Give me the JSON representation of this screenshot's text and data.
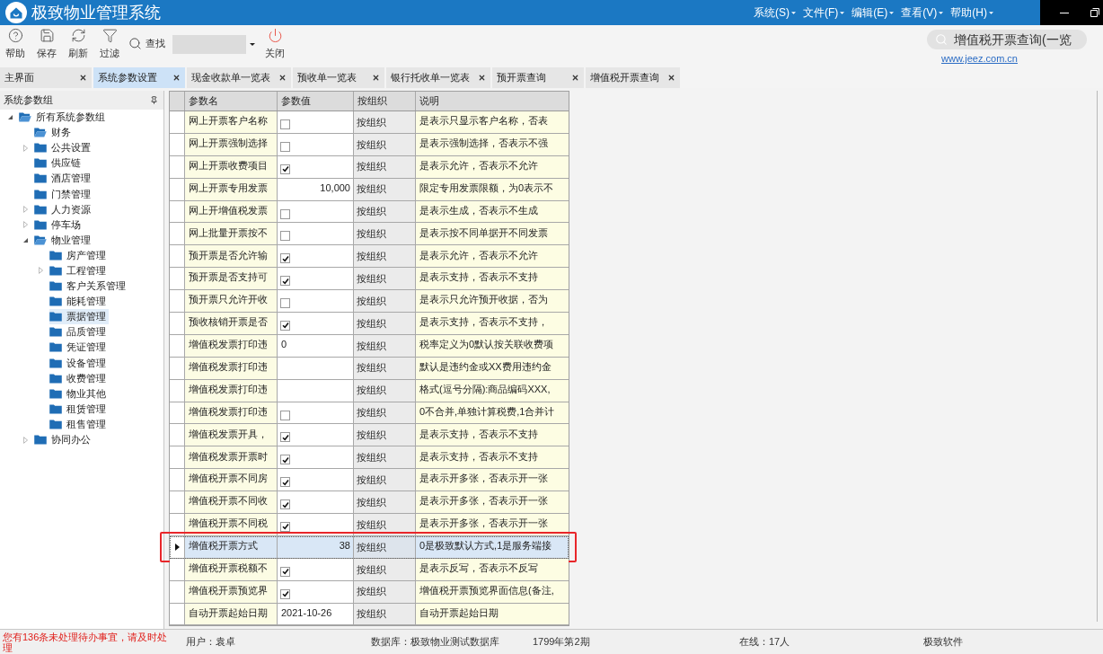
{
  "window": {
    "title": "极致物业管理系统"
  },
  "menu": [
    "系统(S)",
    "文件(F)",
    "编辑(E)",
    "查看(V)",
    "帮助(H)"
  ],
  "toolbar": {
    "buttons": [
      {
        "kind": "help",
        "label": "帮助"
      },
      {
        "kind": "save",
        "label": "保存"
      },
      {
        "kind": "refresh",
        "label": "刷新"
      },
      {
        "kind": "filter",
        "label": "过滤"
      }
    ],
    "find_label": "查找",
    "close_label": "关闭"
  },
  "quick_search": {
    "value": "增值税开票查询(一览"
  },
  "website": "www.jeez.com.cn",
  "tabs": [
    {
      "label": "主界面",
      "selected": false
    },
    {
      "label": "系统参数设置",
      "selected": true
    },
    {
      "label": "现金收款单一览表",
      "selected": false
    },
    {
      "label": "预收单一览表",
      "selected": false
    },
    {
      "label": "银行托收单一览表",
      "selected": false
    },
    {
      "label": "预开票查询",
      "selected": false
    },
    {
      "label": "增值税开票查询",
      "selected": false
    }
  ],
  "sidebar": {
    "title": "系统参数组",
    "tree": [
      {
        "label": "所有系统参数组",
        "kind": "group",
        "expanded": true,
        "selected": false,
        "children": [
          {
            "label": "财务",
            "kind": "leaf",
            "expanded": true,
            "selected": false
          },
          {
            "label": "公共设置",
            "kind": "group",
            "expanded": false,
            "selected": false
          },
          {
            "label": "供应链",
            "kind": "leaf",
            "expanded": false,
            "selected": false
          },
          {
            "label": "酒店管理",
            "kind": "leaf",
            "expanded": false,
            "selected": false
          },
          {
            "label": "门禁管理",
            "kind": "leaf",
            "expanded": false,
            "selected": false
          },
          {
            "label": "人力资源",
            "kind": "group",
            "expanded": false,
            "selected": false
          },
          {
            "label": "停车场",
            "kind": "group",
            "expanded": false,
            "selected": false
          },
          {
            "label": "物业管理",
            "kind": "group",
            "expanded": true,
            "selected": false,
            "children": [
              {
                "label": "房产管理",
                "kind": "leaf",
                "expanded": false,
                "selected": false
              },
              {
                "label": "工程管理",
                "kind": "group",
                "expanded": false,
                "selected": false
              },
              {
                "label": "客户关系管理",
                "kind": "leaf",
                "expanded": false,
                "selected": false
              },
              {
                "label": "能耗管理",
                "kind": "leaf",
                "expanded": false,
                "selected": false
              },
              {
                "label": "票据管理",
                "kind": "leaf",
                "expanded": false,
                "selected": true
              },
              {
                "label": "品质管理",
                "kind": "leaf",
                "expanded": false,
                "selected": false
              },
              {
                "label": "凭证管理",
                "kind": "leaf",
                "expanded": false,
                "selected": false
              },
              {
                "label": "设备管理",
                "kind": "leaf",
                "expanded": false,
                "selected": false
              },
              {
                "label": "收费管理",
                "kind": "leaf",
                "expanded": false,
                "selected": false
              },
              {
                "label": "物业其他",
                "kind": "leaf",
                "expanded": false,
                "selected": false
              },
              {
                "label": "租赁管理",
                "kind": "leaf",
                "expanded": false,
                "selected": false
              },
              {
                "label": "租售管理",
                "kind": "leaf",
                "expanded": false,
                "selected": false
              }
            ]
          },
          {
            "label": "协同办公",
            "kind": "group",
            "expanded": false,
            "selected": false
          }
        ]
      }
    ]
  },
  "table": {
    "columns": [
      "参数名",
      "参数值",
      "按组织",
      "说明"
    ],
    "rows": [
      {
        "name": "网上开票客户名称",
        "kind": "checkbox",
        "checked": false,
        "scope": "按组织",
        "description": "是表示只显示客户名称，否表",
        "selected": false,
        "highlighted": false
      },
      {
        "name": "网上开票强制选择",
        "kind": "checkbox",
        "checked": false,
        "scope": "按组织",
        "description": "是表示强制选择，否表示不强",
        "selected": false,
        "highlighted": false
      },
      {
        "name": "网上开票收费项目",
        "kind": "checkbox",
        "checked": true,
        "scope": "按组织",
        "description": "是表示允许，否表示不允许",
        "selected": false,
        "highlighted": false
      },
      {
        "name": "网上开票专用发票",
        "kind": "number",
        "value": "10,000",
        "scope": "按组织",
        "description": "限定专用发票限额，为0表示不",
        "selected": false,
        "highlighted": false
      },
      {
        "name": "网上开增值税发票",
        "kind": "checkbox",
        "checked": false,
        "scope": "按组织",
        "description": "是表示生成，否表示不生成",
        "selected": false,
        "highlighted": false
      },
      {
        "name": "网上批量开票按不",
        "kind": "checkbox",
        "checked": false,
        "scope": "按组织",
        "description": "是表示按不同单据开不同发票",
        "selected": false,
        "highlighted": false
      },
      {
        "name": "预开票是否允许输",
        "kind": "checkbox",
        "checked": true,
        "scope": "按组织",
        "description": "是表示允许，否表示不允许",
        "selected": false,
        "highlighted": false
      },
      {
        "name": "预开票是否支持可",
        "kind": "checkbox",
        "checked": true,
        "scope": "按组织",
        "description": "是表示支持，否表示不支持",
        "selected": false,
        "highlighted": false
      },
      {
        "name": "预开票只允许开收",
        "kind": "checkbox",
        "checked": false,
        "scope": "按组织",
        "description": "是表示只允许预开收据，否为",
        "selected": false,
        "highlighted": false
      },
      {
        "name": "预收核销开票是否",
        "kind": "checkbox",
        "checked": true,
        "scope": "按组织",
        "description": "是表示支持，否表示不支持，",
        "selected": false,
        "highlighted": false
      },
      {
        "name": "增值税发票打印违",
        "kind": "text",
        "value": "0",
        "scope": "按组织",
        "description": "税率定义为0默认按关联收费项",
        "selected": false,
        "highlighted": false
      },
      {
        "name": "增值税发票打印违",
        "kind": "empty",
        "scope": "按组织",
        "description": "默认是违约金或XX费用违约金",
        "selected": false,
        "highlighted": false
      },
      {
        "name": "增值税发票打印违",
        "kind": "empty",
        "scope": "按组织",
        "description": "格式(逗号分隔):商品编码XXX,",
        "selected": false,
        "highlighted": false
      },
      {
        "name": "增值税发票打印违",
        "kind": "checkbox",
        "checked": false,
        "scope": "按组织",
        "description": "0不合并,单独计算税费,1合并计",
        "selected": false,
        "highlighted": false
      },
      {
        "name": "增值税发票开具，",
        "kind": "checkbox",
        "checked": true,
        "scope": "按组织",
        "description": "是表示支持，否表示不支持",
        "selected": false,
        "highlighted": false
      },
      {
        "name": "增值税发票开票时",
        "kind": "checkbox",
        "checked": true,
        "scope": "按组织",
        "description": "是表示支持，否表示不支持",
        "selected": false,
        "highlighted": false
      },
      {
        "name": "增值税开票不同房",
        "kind": "checkbox",
        "checked": true,
        "scope": "按组织",
        "description": "是表示开多张，否表示开一张",
        "selected": false,
        "highlighted": false
      },
      {
        "name": "增值税开票不同收",
        "kind": "checkbox",
        "checked": true,
        "scope": "按组织",
        "description": "是表示开多张，否表示开一张",
        "selected": false,
        "highlighted": false
      },
      {
        "name": "增值税开票不同税",
        "kind": "checkbox",
        "checked": true,
        "scope": "按组织",
        "description": "是表示开多张，否表示开一张",
        "selected": false,
        "highlighted": false
      },
      {
        "name": "增值税开票方式",
        "kind": "number",
        "value": "38",
        "scope": "按组织",
        "description": "0是极致默认方式,1是服务端接",
        "selected": true,
        "highlighted": true
      },
      {
        "name": "增值税开票税额不",
        "kind": "checkbox",
        "checked": true,
        "scope": "按组织",
        "description": "是表示反写，否表示不反写",
        "selected": false,
        "highlighted": false
      },
      {
        "name": "增值税开票预览界",
        "kind": "checkbox",
        "checked": true,
        "scope": "按组织",
        "description": "增值税开票预览界面信息(备注,",
        "selected": false,
        "highlighted": false
      },
      {
        "name": "自动开票起始日期",
        "kind": "text",
        "value": "2021-10-26",
        "scope": "按组织",
        "description": "自动开票起始日期",
        "selected": false,
        "highlighted": false
      }
    ]
  },
  "status_bar": {
    "alert": "您有136条未处理待办事宜，请及时处理",
    "fields": [
      "用户：袁卓",
      "数据库：极致物业测试数据库",
      "1799年第2期",
      "在线：17人",
      "极致软件"
    ]
  }
}
